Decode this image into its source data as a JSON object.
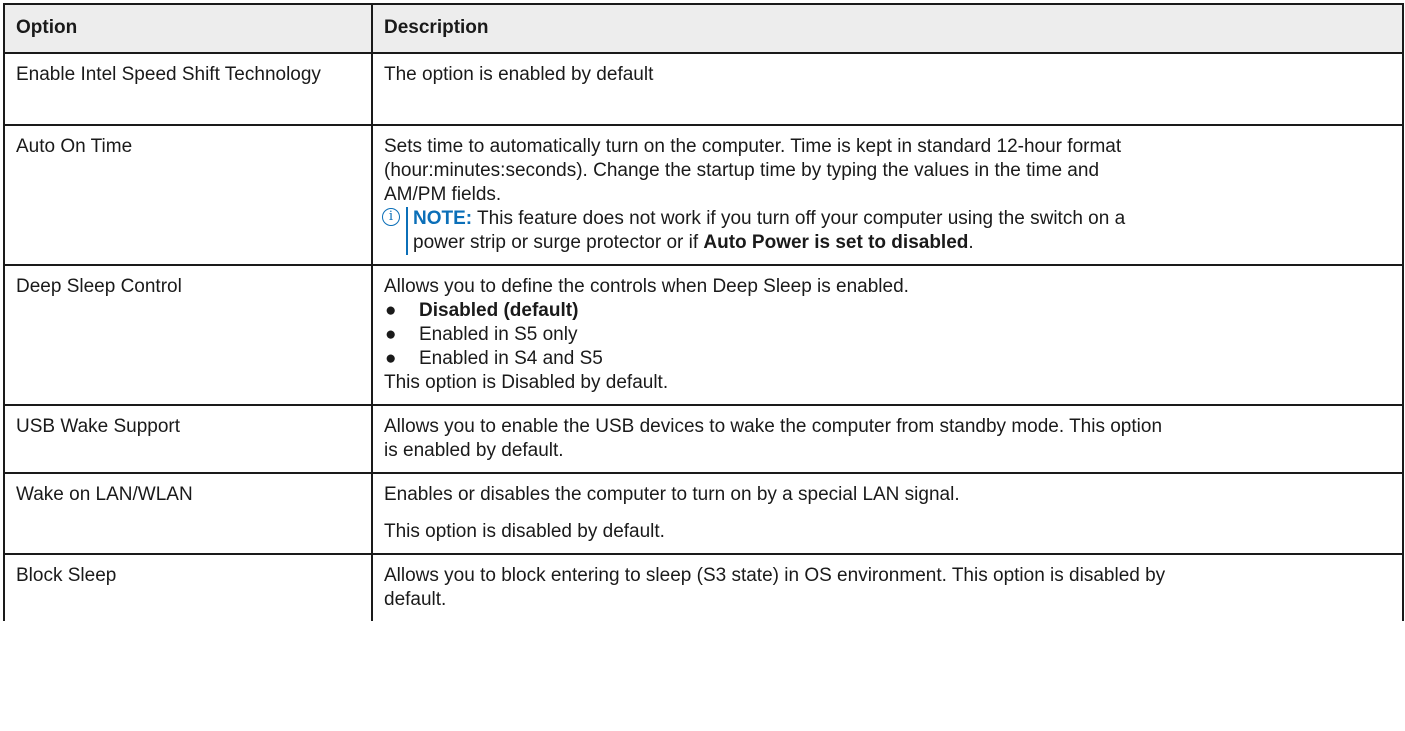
{
  "header": {
    "col_option": "Option",
    "col_description": "Description"
  },
  "rows": {
    "speed_shift": {
      "option": "Enable Intel Speed Shift Technology",
      "description": "The option is enabled by default"
    },
    "auto_on": {
      "option": "Auto On Time",
      "description_lines": [
        "Sets time to automatically turn on the computer. Time is kept in standard 12-hour format",
        "(hour:minutes:seconds). Change the startup time by typing the values in the time and",
        "AM/PM fields."
      ],
      "note": {
        "label": "NOTE:",
        "text_1": " This feature does not work if you turn off your computer using the switch on a",
        "text_2": "power strip or surge protector or if ",
        "bold": "Auto Power is set to disabled",
        "end": "."
      }
    },
    "deep_sleep": {
      "option": "Deep Sleep Control",
      "intro": "Allows you to define the controls when Deep Sleep is enabled.",
      "bullets": [
        "Disabled (default)",
        "Enabled in S5 only",
        "Enabled in S4 and S5"
      ],
      "outro": "This option is Disabled by default."
    },
    "usb_wake": {
      "option": "USB Wake Support",
      "line1": "Allows you to enable the USB devices to wake the computer from standby mode. This option",
      "line2": "is enabled by default."
    },
    "wake_lan": {
      "option": "Wake on LAN/WLAN",
      "para1": "Enables or disables the computer to turn on by a special LAN signal.",
      "para2": "This option is disabled by default."
    },
    "block_sleep": {
      "option": "Block Sleep",
      "line1": "Allows you to block entering to sleep (S3 state) in OS environment. This option is disabled by",
      "line2": "default."
    }
  },
  "icons": {
    "note": "info-icon",
    "bullet": "●"
  },
  "colors": {
    "note_accent": "#0b6fb8",
    "header_bg": "#ededed",
    "border": "#1a1a1a"
  }
}
